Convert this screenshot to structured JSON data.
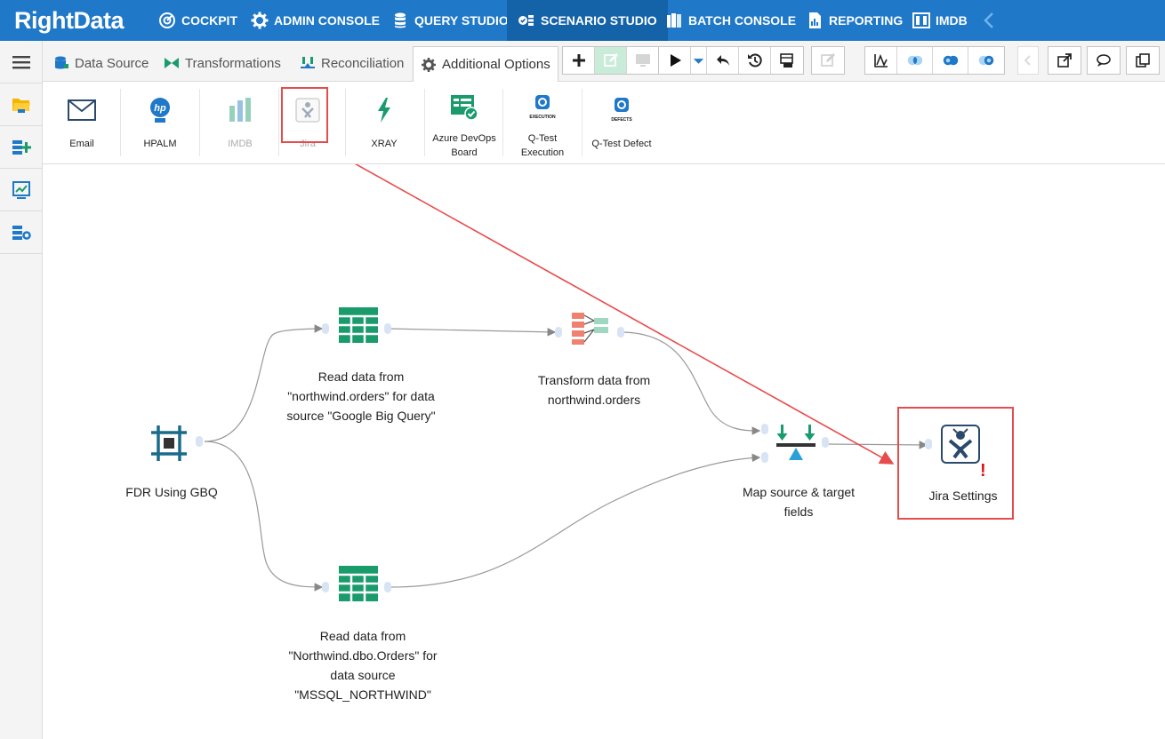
{
  "brand": {
    "logo_text": "RightData"
  },
  "topnav": {
    "items": [
      {
        "label": "COCKPIT",
        "icon": "cockpit-icon"
      },
      {
        "label": "ADMIN CONSOLE",
        "icon": "gear-icon"
      },
      {
        "label": "QUERY STUDIO",
        "icon": "database-icon"
      },
      {
        "label": "SCENARIO STUDIO",
        "icon": "scenario-icon",
        "active": true
      },
      {
        "label": "BATCH CONSOLE",
        "icon": "batch-icon"
      },
      {
        "label": "REPORTING",
        "icon": "report-icon"
      },
      {
        "label": "IMDB",
        "icon": "imdb-icon"
      }
    ]
  },
  "tabs": [
    {
      "label": "Data Source",
      "icon": "database-icon"
    },
    {
      "label": "Transformations",
      "icon": "transform-icon"
    },
    {
      "label": "Reconciliation",
      "icon": "reconcile-icon"
    },
    {
      "label": "Additional Options",
      "icon": "gear-icon",
      "active": true
    }
  ],
  "options": [
    {
      "label": "Email",
      "icon": "email-icon"
    },
    {
      "label": "HPALM",
      "icon": "hpalm-icon"
    },
    {
      "label": "IMDB",
      "icon": "imdb-icon",
      "disabled": true
    },
    {
      "label": "Jira",
      "icon": "jira-icon",
      "disabled": true
    },
    {
      "label": "XRAY",
      "icon": "xray-icon"
    },
    {
      "label": "Azure DevOps Board",
      "icon": "azure-devops-icon"
    },
    {
      "label": "Q-Test Execution",
      "icon": "qtest-execution-icon",
      "sublabel": "EXECUTION"
    },
    {
      "label": "Q-Test Defect",
      "icon": "qtest-defect-icon",
      "sublabel": "DEFECTS"
    }
  ],
  "flow": {
    "nodes": {
      "fdr": {
        "label": "FDR Using GBQ"
      },
      "read1": {
        "label": "Read data from \"northwind.orders\" for data source \"Google Big Query\""
      },
      "read2": {
        "label": "Read data from \"Northwind.dbo.Orders\" for data source \"MSSQL_NORTHWIND\""
      },
      "transform": {
        "label": "Transform data from northwind.orders"
      },
      "map": {
        "label": "Map source & target fields"
      },
      "jira": {
        "label": "Jira Settings",
        "warning": "!"
      }
    }
  },
  "colors": {
    "nav_bg": "#1f78c8",
    "nav_active": "#1462a8",
    "accent_green": "#1a9b6c",
    "highlight_red": "#e74c4c",
    "warning_red": "#e01010"
  }
}
